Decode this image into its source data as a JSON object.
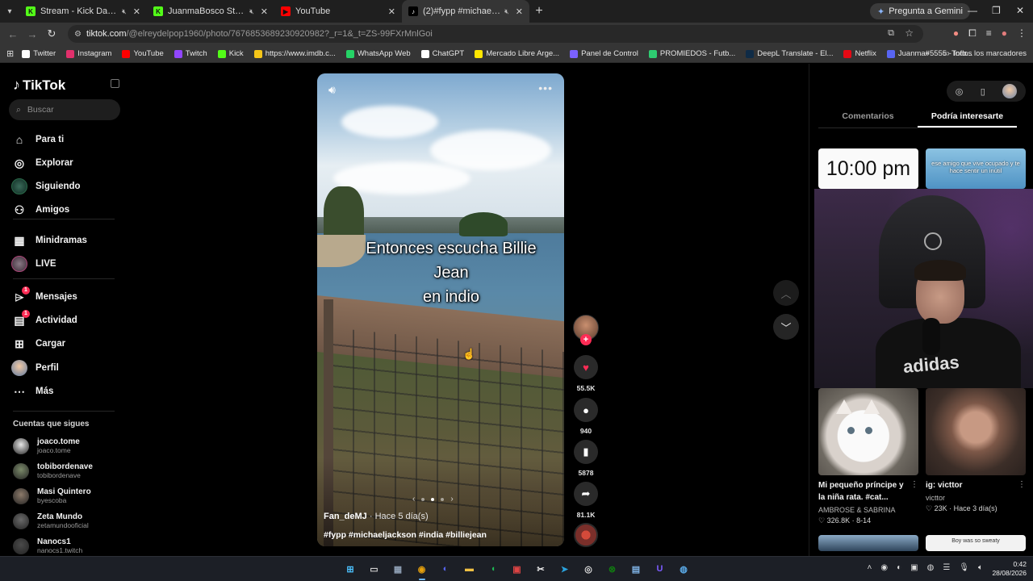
{
  "browser": {
    "tabs": [
      {
        "title": "Stream - Kick Dashboard",
        "muted": true,
        "favicon": "kick-icon",
        "color": "#53fc18"
      },
      {
        "title": "JuanmaBosco Stream - Wat",
        "muted": true,
        "favicon": "kick-icon",
        "color": "#53fc18"
      },
      {
        "title": "YouTube",
        "muted": false,
        "favicon": "youtube-icon",
        "color": "#ff0000"
      },
      {
        "title": "(2)#fypp #michaeljackson #",
        "muted": true,
        "favicon": "tiktok-icon",
        "color": "#ffffff",
        "active": true
      }
    ],
    "gemini_button": "Pregunta a Gemini",
    "url_host": "tiktok.com",
    "url_path": "/@elreydelpop1960/photo/7676853689230920982?_r=1&_t=ZS-99FXrMnlGoi",
    "bookmarks": [
      {
        "label": "Twitter",
        "icon": "x-icon",
        "color": "#ffffff"
      },
      {
        "label": "Instagram",
        "icon": "instagram-icon",
        "color": "#e1306c"
      },
      {
        "label": "YouTube",
        "icon": "youtube-icon",
        "color": "#ff0000"
      },
      {
        "label": "Twitch",
        "icon": "twitch-icon",
        "color": "#9146ff"
      },
      {
        "label": "Kick",
        "icon": "kick-icon",
        "color": "#53fc18"
      },
      {
        "label": "https://www.imdb.c...",
        "icon": "imdb-icon",
        "color": "#f5c518"
      },
      {
        "label": "WhatsApp Web",
        "icon": "whatsapp-icon",
        "color": "#25d366"
      },
      {
        "label": "ChatGPT",
        "icon": "chatgpt-icon",
        "color": "#ffffff"
      },
      {
        "label": "Mercado Libre Arge...",
        "icon": "mercadolibre-icon",
        "color": "#ffe600"
      },
      {
        "label": "Panel de Control",
        "icon": "panel-icon",
        "color": "#7b61ff"
      },
      {
        "label": "PROMIEDOS - Futb...",
        "icon": "promiedos-icon",
        "color": "#2ecc71"
      },
      {
        "label": "DeepL Translate - El...",
        "icon": "deepl-icon",
        "color": "#0f2b46"
      },
      {
        "label": "Netflix",
        "icon": "netflix-icon",
        "color": "#e50914"
      },
      {
        "label": "Juanma#5555 - Info...",
        "icon": "discord-icon",
        "color": "#5865f2"
      }
    ],
    "all_bookmarks": "Todos los marcadores"
  },
  "tiktok": {
    "logo": "TikTok",
    "search_placeholder": "Buscar",
    "nav": [
      {
        "label": "Para ti",
        "icon": "home-icon"
      },
      {
        "label": "Explorar",
        "icon": "compass-icon"
      },
      {
        "label": "Siguiendo",
        "icon": "following-icon"
      },
      {
        "label": "Amigos",
        "icon": "friends-icon"
      },
      {
        "label": "Minidramas",
        "icon": "minidramas-icon"
      },
      {
        "label": "LIVE",
        "icon": "live-icon"
      },
      {
        "label": "Mensajes",
        "icon": "messages-icon",
        "badge": "1"
      },
      {
        "label": "Actividad",
        "icon": "activity-icon",
        "badge": "1"
      },
      {
        "label": "Cargar",
        "icon": "upload-icon"
      },
      {
        "label": "Perfil",
        "icon": "profile-icon"
      },
      {
        "label": "Más",
        "icon": "more-icon"
      }
    ],
    "following_title": "Cuentas que sigues",
    "following": [
      {
        "name": "joaco.tome",
        "handle": "joaco.tome",
        "color": "#e7e7e7"
      },
      {
        "name": "tobibordenave",
        "handle": "tobibordenave",
        "color": "#7b8a6a"
      },
      {
        "name": "Masi Quintero",
        "handle": "byescoba",
        "color": "#8c7a6a"
      },
      {
        "name": "Zeta Mundo",
        "handle": "zetamundooficial",
        "color": "#6a6a6a"
      },
      {
        "name": "Nanocs1",
        "handle": "nanocs1.twitch",
        "color": "#4a4a4a"
      }
    ]
  },
  "post": {
    "overlay_text": [
      "Entonces escucha Billie",
      "Jean",
      "en indio"
    ],
    "author": "Fan_deMJ",
    "time": "Hace 5 día(s)",
    "hashtags": "#fypp #michaeljackson #india #billiejean",
    "likes": "55.5K",
    "comments": "940",
    "saves": "5878",
    "shares": "81.1K"
  },
  "right_panel": {
    "tabs": [
      "Comentarios",
      "Podría interesarte"
    ],
    "active_tab": "Podría interesarte",
    "thumb_clock": "10:00 pm",
    "thumb_meme": "ese amigo que vive ocupado y te hace sentir un inútil",
    "thumb_bottom_text": "Boy was so sweaty",
    "cards": [
      {
        "title": "Mi pequeño príncipe y la niña rata. #cat...",
        "user": "AMBROSE & SABRINA",
        "likes": "326.8K",
        "date": "8-14"
      },
      {
        "title": "ig: victtor",
        "user": "victtor",
        "likes": "23K",
        "date": "Hace 3 día(s)"
      }
    ],
    "webcam_shirt_text": "adidas"
  },
  "taskbar": {
    "apps": [
      {
        "icon": "windows-start-icon",
        "color": "#4cc2ff"
      },
      {
        "icon": "task-view-icon",
        "color": "#cfcfcf"
      },
      {
        "icon": "calculator-icon",
        "color": "#8fa0b5"
      },
      {
        "icon": "chrome-icon",
        "color": "#e5a00d",
        "active": true
      },
      {
        "icon": "discord-icon",
        "color": "#5865f2"
      },
      {
        "icon": "file-explorer-icon",
        "color": "#f0c043"
      },
      {
        "icon": "spotify-icon",
        "color": "#1db954"
      },
      {
        "icon": "capture-icon",
        "color": "#d44"
      },
      {
        "icon": "capcut-icon",
        "color": "#eeeeee"
      },
      {
        "icon": "telegram-icon",
        "color": "#2aa3de"
      },
      {
        "icon": "obs-icon",
        "color": "#dddddd"
      },
      {
        "icon": "xbox-icon",
        "color": "#107c10"
      },
      {
        "icon": "notepad-icon",
        "color": "#7fb3e6"
      },
      {
        "icon": "proton-icon",
        "color": "#7c5cff"
      },
      {
        "icon": "steam-app-icon",
        "color": "#5aa9e6"
      }
    ],
    "time": "0:42",
    "date": "28/08/2026"
  }
}
